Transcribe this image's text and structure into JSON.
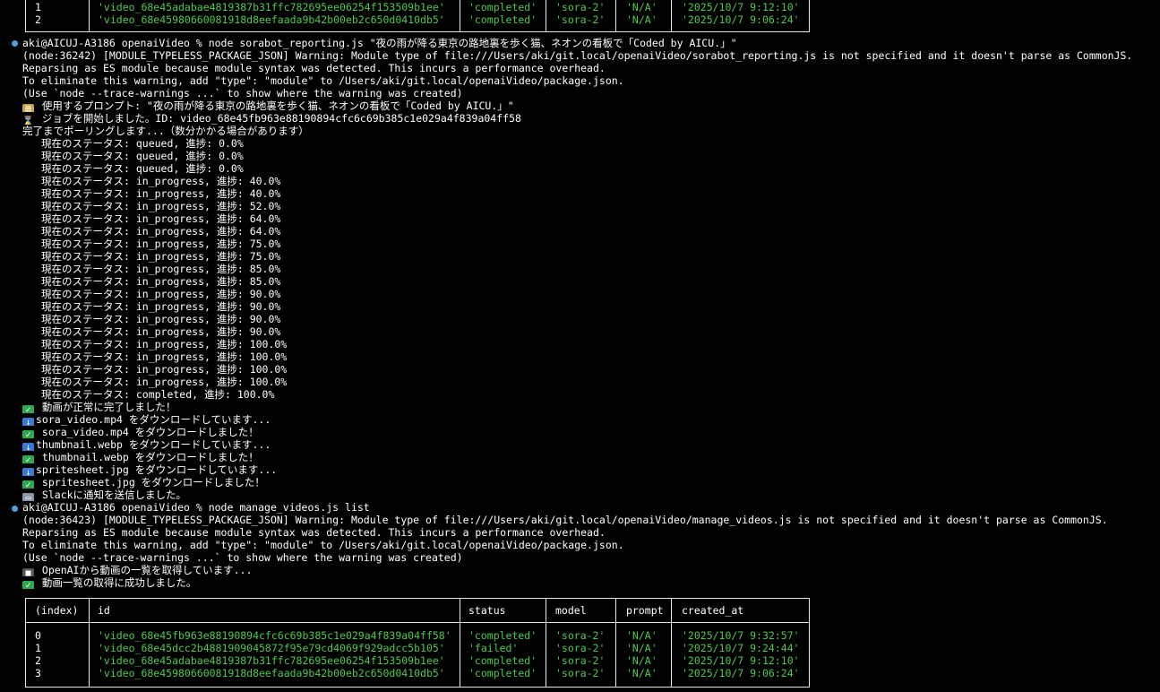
{
  "table_top": {
    "rows": [
      {
        "index": "1",
        "id": "'video_68e45adabae4819387b31ffc782695ee06254f153509b1ee'",
        "status": "'completed'",
        "model": "'sora-2'",
        "prompt": "'N/A'",
        "created_at": "'2025/10/7 9:12:10'"
      },
      {
        "index": "2",
        "id": "'video_68e45980660081918d8eefaada9b42b00eb2c650d0410db5'",
        "status": "'completed'",
        "model": "'sora-2'",
        "prompt": "'N/A'",
        "created_at": "'2025/10/7 9:06:24'"
      }
    ]
  },
  "session1": {
    "prompt_line": "aki@AICUJ-A3186 openaiVideo % node sorabot_reporting.js \"夜の雨が降る東京の路地裏を歩く猫、ネオンの看板で「Coded by AICU.」\"",
    "warning1": "(node:36242) [MODULE_TYPELESS_PACKAGE_JSON] Warning: Module type of file:///Users/aki/git.local/openaiVideo/sorabot_reporting.js is not specified and it doesn't parse as CommonJS.",
    "warning2": "Reparsing as ES module because module syntax was detected. This incurs a performance overhead.",
    "warning3": "To eliminate this warning, add \"type\": \"module\" to /Users/aki/git.local/openaiVideo/package.json.",
    "warning4": "(Use `node --trace-warnings ...` to show where the warning was created)",
    "used_prompt": " 使用するプロンプト: \"夜の雨が降る東京の路地裏を歩く猫、ネオンの看板で「Coded by AICU.」\"",
    "job_started": " ジョブを開始しました。ID: video_68e45fb963e88190894cfc6c69b385c1e029a4f839a04ff58",
    "polling": "完了までポーリングします...（数分かかる場合があります）",
    "statuses": [
      "現在のステータス: queued, 進捗: 0.0%",
      "現在のステータス: queued, 進捗: 0.0%",
      "現在のステータス: queued, 進捗: 0.0%",
      "現在のステータス: in_progress, 進捗: 40.0%",
      "現在のステータス: in_progress, 進捗: 40.0%",
      "現在のステータス: in_progress, 進捗: 52.0%",
      "現在のステータス: in_progress, 進捗: 64.0%",
      "現在のステータス: in_progress, 進捗: 64.0%",
      "現在のステータス: in_progress, 進捗: 75.0%",
      "現在のステータス: in_progress, 進捗: 75.0%",
      "現在のステータス: in_progress, 進捗: 85.0%",
      "現在のステータス: in_progress, 進捗: 85.0%",
      "現在のステータス: in_progress, 進捗: 90.0%",
      "現在のステータス: in_progress, 進捗: 90.0%",
      "現在のステータス: in_progress, 進捗: 90.0%",
      "現在のステータス: in_progress, 進捗: 90.0%",
      "現在のステータス: in_progress, 進捗: 100.0%",
      "現在のステータス: in_progress, 進捗: 100.0%",
      "現在のステータス: in_progress, 進捗: 100.0%",
      "現在のステータス: in_progress, 進捗: 100.0%",
      "現在のステータス: completed, 進捗: 100.0%"
    ],
    "done": " 動画が正常に完了しました！",
    "dl_video": "sora_video.mp4 をダウンロードしています...",
    "dl_video_done": " sora_video.mp4 をダウンロードしました！",
    "dl_thumb": "thumbnail.webp をダウンロードしています...",
    "dl_thumb_done": " thumbnail.webp をダウンロードしました！",
    "dl_sprite": "spritesheet.jpg をダウンロードしています...",
    "dl_sprite_done": " spritesheet.jpg をダウンロードしました！",
    "slack": " Slackに通知を送信しました。"
  },
  "session2": {
    "prompt_line": "aki@AICUJ-A3186 openaiVideo % node manage_videos.js list",
    "warning1": "(node:36423) [MODULE_TYPELESS_PACKAGE_JSON] Warning: Module type of file:///Users/aki/git.local/openaiVideo/manage_videos.js is not specified and it doesn't parse as CommonJS.",
    "warning2": "Reparsing as ES module because module syntax was detected. This incurs a performance overhead.",
    "warning3": "To eliminate this warning, add \"type\": \"module\" to /Users/aki/git.local/openaiVideo/package.json.",
    "warning4": "(Use `node --trace-warnings ...` to show where the warning was created)",
    "fetching": " OpenAIから動画の一覧を取得しています...",
    "fetched": " 動画一覧の取得に成功しました。"
  },
  "table_bottom": {
    "headers": {
      "index": "(index)",
      "id": "id",
      "status": "status",
      "model": "model",
      "prompt": "prompt",
      "created_at": "created_at"
    },
    "rows": [
      {
        "index": "0",
        "id": "'video_68e45fb963e88190894cfc6c69b385c1e029a4f839a04ff58'",
        "status": "'completed'",
        "model": "'sora-2'",
        "prompt": "'N/A'",
        "created_at": "'2025/10/7 9:32:57'"
      },
      {
        "index": "1",
        "id": "'video_68e45dcc2b4881909045872f95e79cd4069f929adcc5b105'",
        "status": "'failed'",
        "model": "'sora-2'",
        "prompt": "'N/A'",
        "created_at": "'2025/10/7 9:24:44'"
      },
      {
        "index": "2",
        "id": "'video_68e45adabae4819387b31ffc782695ee06254f153509b1ee'",
        "status": "'completed'",
        "model": "'sora-2'",
        "prompt": "'N/A'",
        "created_at": "'2025/10/7 9:12:10'"
      },
      {
        "index": "3",
        "id": "'video_68e45980660081918d8eefaada9b42b00eb2c650d0410db5'",
        "status": "'completed'",
        "model": "'sora-2'",
        "prompt": "'N/A'",
        "created_at": "'2025/10/7 9:06:24'"
      }
    ]
  },
  "colors": {
    "background": "#000000",
    "text": "#ffffff",
    "string_value": "#4ec94e",
    "prompt_marker": "#4aa3df",
    "table_border": "#e8e8e8"
  }
}
